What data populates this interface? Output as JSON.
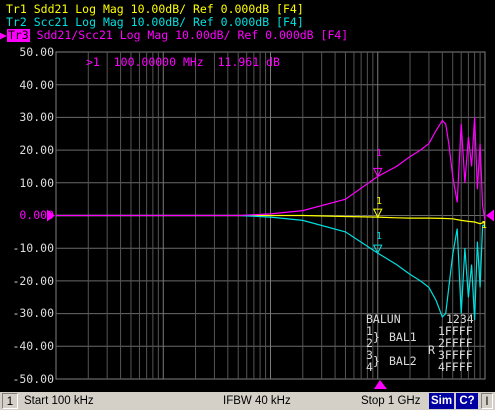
{
  "traces": [
    {
      "label": "Tr1",
      "text": "Sdd21 Log Mag 10.00dB/ Ref 0.000dB [F4]",
      "color": "#ffff00",
      "active": false
    },
    {
      "label": "Tr2",
      "text": "Scc21 Log Mag 10.00dB/ Ref 0.000dB [F4]",
      "color": "#00e0e0",
      "active": false
    },
    {
      "label": "Tr3",
      "text": "Sdd21/Scc21 Log Mag 10.00dB/ Ref 0.000dB [F4]",
      "color": "#ff00ff",
      "active": true
    }
  ],
  "y_axis": {
    "ticks": [
      "50.00",
      "40.00",
      "30.00",
      "20.00",
      "10.00",
      "0.000",
      "-10.00",
      "-20.00",
      "-30.00",
      "-40.00",
      "-50.00"
    ],
    "ref_label": "0.000"
  },
  "marker_readout": {
    "id": ">1",
    "freq": "100.00000 MHz",
    "value": "11.961 dB"
  },
  "balun": {
    "title": "BALUN",
    "ports_label": "1234",
    "row1_ports": "1",
    "row1_name": "BAL1",
    "row1_code": "1FFFF",
    "row2_ports": "2",
    "row2_code": "2FFFF",
    "row3_ports": "3",
    "row3_name": "BAL2",
    "row3_code": "3FFFF",
    "row4_ports": "4",
    "row4_code": "4FFFF",
    "r_flag": "R"
  },
  "marker_tags": [
    "1",
    "1",
    "1",
    "1"
  ],
  "status": {
    "channel": "1",
    "start": "Start 100 kHz",
    "ifbw": "IFBW 40 kHz",
    "stop": "Stop 1 GHz",
    "sim": "Sim",
    "cal": "C?",
    "extra": "I"
  },
  "chart_data": {
    "type": "line",
    "x_scale": "log",
    "x_range_hz": [
      100000,
      1000000000
    ],
    "ylim": [
      -50,
      50
    ],
    "y_unit": "dB",
    "grid": true,
    "series": [
      {
        "name": "Sdd21",
        "color": "#ffff00",
        "x": [
          100000,
          1000000,
          5000000,
          10000000,
          20000000,
          50000000,
          100000000,
          150000000,
          200000000,
          300000000,
          400000000,
          500000000,
          600000000,
          700000000,
          800000000,
          900000000,
          1000000000
        ],
        "y": [
          0,
          0,
          0,
          0,
          0,
          -0.3,
          -0.5,
          -0.7,
          -0.8,
          -0.8,
          -0.9,
          -1.0,
          -1.5,
          -1.8,
          -2.0,
          -2.5,
          -2.0
        ]
      },
      {
        "name": "Scc21",
        "color": "#00e0e0",
        "x": [
          100000,
          1000000,
          5000000,
          10000000,
          20000000,
          50000000,
          100000000,
          150000000,
          200000000,
          250000000,
          300000000,
          350000000,
          400000000,
          430000000,
          460000000,
          500000000,
          550000000,
          600000000,
          650000000,
          700000000,
          750000000,
          800000000,
          850000000,
          900000000,
          950000000,
          1000000000
        ],
        "y": [
          0,
          0,
          0,
          -0.5,
          -1.5,
          -5,
          -11.5,
          -15,
          -18,
          -20,
          -22,
          -26,
          -31,
          -30,
          -22,
          -12,
          -4,
          -30,
          -10,
          -25,
          -15,
          -32,
          -8,
          -22,
          -3,
          -3
        ]
      },
      {
        "name": "Sdd21/Scc21",
        "color": "#ff00ff",
        "x": [
          100000,
          1000000,
          5000000,
          10000000,
          20000000,
          50000000,
          100000000,
          150000000,
          200000000,
          250000000,
          300000000,
          350000000,
          400000000,
          430000000,
          460000000,
          500000000,
          550000000,
          600000000,
          650000000,
          700000000,
          750000000,
          800000000,
          850000000,
          900000000,
          950000000,
          1000000000
        ],
        "y": [
          0,
          0,
          0,
          0.5,
          1.5,
          5,
          11.961,
          15,
          18,
          20,
          22,
          26,
          29,
          28,
          22,
          12,
          4,
          28,
          10,
          24,
          15,
          30,
          8,
          22,
          3,
          -1.5
        ]
      }
    ]
  }
}
